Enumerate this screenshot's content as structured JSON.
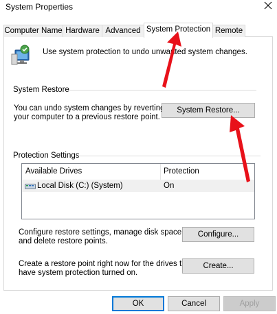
{
  "window": {
    "title": "System Properties",
    "close_glyph": "✕"
  },
  "tabs": [
    {
      "label": "Computer Name",
      "active": false
    },
    {
      "label": "Hardware",
      "active": false
    },
    {
      "label": "Advanced",
      "active": false
    },
    {
      "label": "System Protection",
      "active": true
    },
    {
      "label": "Remote",
      "active": false
    }
  ],
  "intro": {
    "icon": "system-shield-icon",
    "text": "Use system protection to undo unwanted system changes."
  },
  "system_restore": {
    "heading": "System Restore",
    "description_line1": "You can undo system changes by reverting",
    "description_line2": "your computer to a previous restore point.",
    "button": "System Restore..."
  },
  "protection_settings": {
    "heading": "Protection Settings",
    "columns": [
      "Available Drives",
      "Protection"
    ],
    "rows": [
      {
        "drive": "Local Disk (C:) (System)",
        "protection": "On",
        "icon": "drive-icon"
      }
    ],
    "configure_text_line1": "Configure restore settings, manage disk space,",
    "configure_text_line2": "and delete restore points.",
    "configure_button": "Configure...",
    "create_text_line1": "Create a restore point right now for the drives that",
    "create_text_line2": "have system protection turned on.",
    "create_button": "Create..."
  },
  "footer": {
    "ok": "OK",
    "cancel": "Cancel",
    "apply": "Apply"
  },
  "colors": {
    "annotation_arrow": "#e8111a",
    "accent_border": "#0078d7"
  }
}
